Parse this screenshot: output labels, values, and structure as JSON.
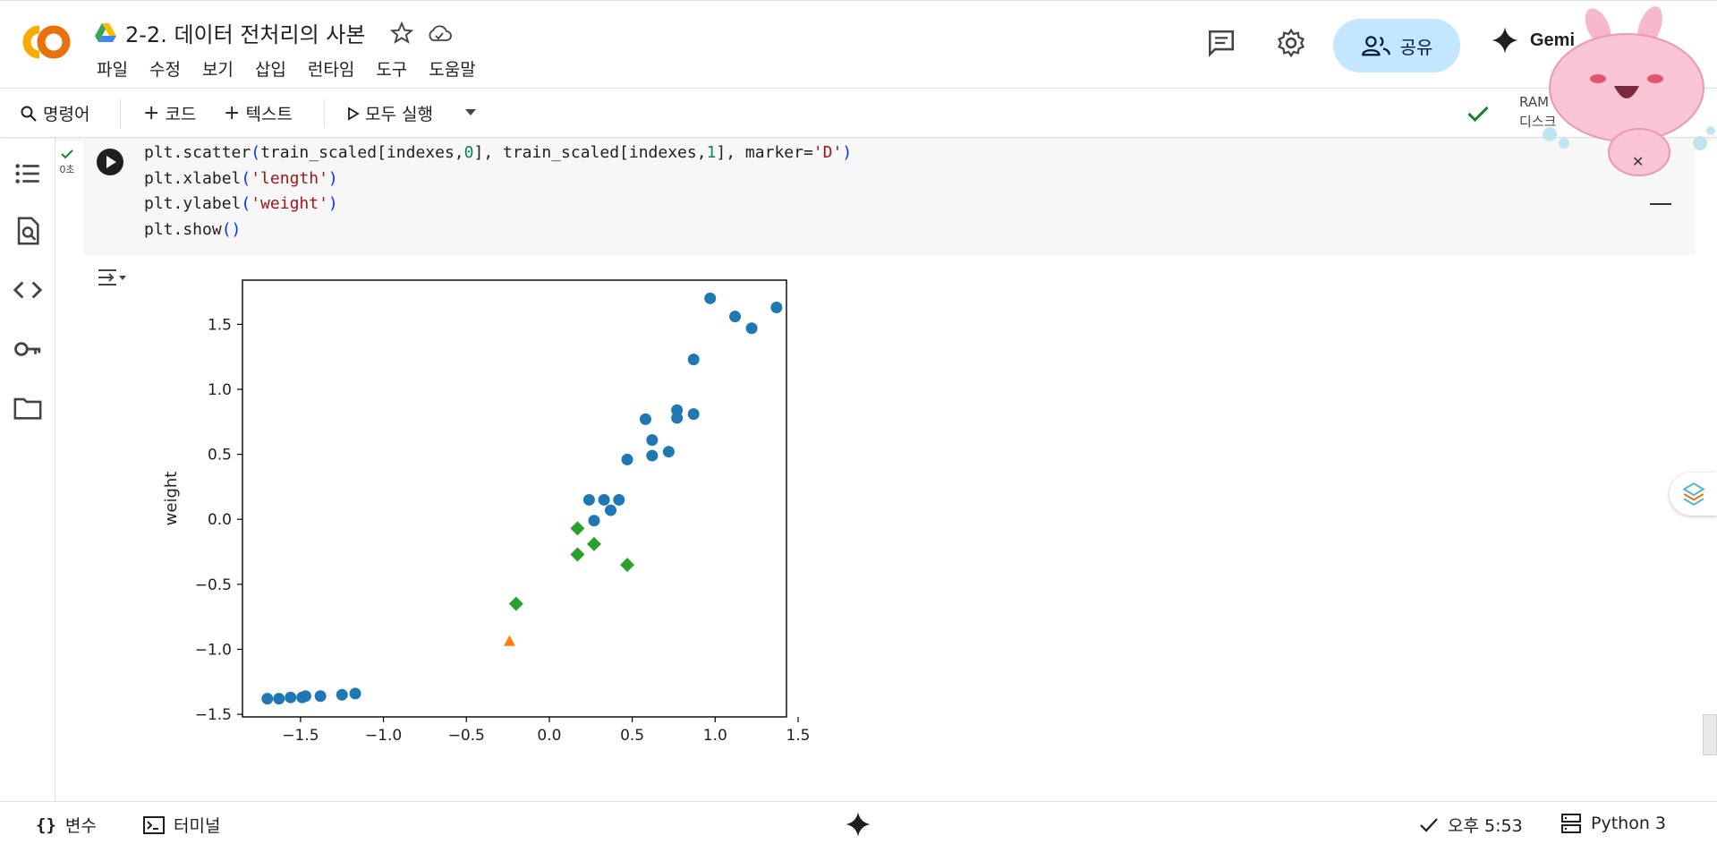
{
  "header": {
    "doc_title": "2-2. 데이터 전처리의 사본",
    "menu": [
      "파일",
      "수정",
      "보기",
      "삽입",
      "런타임",
      "도구",
      "도움말"
    ],
    "share_label": "공유",
    "gemini_label": "Gemi"
  },
  "toolbar": {
    "commands_label": "명령어",
    "code_label": "코드",
    "text_label": "텍스트",
    "run_all_label": "모두 실행",
    "ram_label": "RAM",
    "disk_label": "디스크"
  },
  "cell": {
    "exec_time": "0초",
    "code_lines": [
      [
        {
          "t": "plt.scatter"
        },
        {
          "t": "(",
          "c": "paren"
        },
        {
          "t": "train_scaled[indexes,"
        },
        {
          "t": "0",
          "c": "num"
        },
        {
          "t": "], train_scaled[indexes,"
        },
        {
          "t": "1",
          "c": "num"
        },
        {
          "t": "], marker="
        },
        {
          "t": "'D'",
          "c": "str"
        },
        {
          "t": ")",
          "c": "paren"
        }
      ],
      [
        {
          "t": "plt.xlabel"
        },
        {
          "t": "(",
          "c": "paren"
        },
        {
          "t": "'length'",
          "c": "str"
        },
        {
          "t": ")",
          "c": "paren"
        }
      ],
      [
        {
          "t": "plt.ylabel"
        },
        {
          "t": "(",
          "c": "paren"
        },
        {
          "t": "'weight'",
          "c": "str"
        },
        {
          "t": ")",
          "c": "paren"
        }
      ],
      [
        {
          "t": "plt.show"
        },
        {
          "t": "()",
          "c": "paren"
        }
      ]
    ]
  },
  "chart_data": {
    "type": "scatter",
    "title": "",
    "xlabel": "",
    "ylabel": "weight",
    "xlim": [
      -1.85,
      1.43
    ],
    "ylim": [
      -1.52,
      1.84
    ],
    "xticks": [
      -1.5,
      -1.0,
      -0.5,
      0.0,
      0.5,
      1.0,
      1.5
    ],
    "xtick_labels": [
      "−1.5",
      "−1.0",
      "−0.5",
      "0.0",
      "0.5",
      "1.0",
      "1.5"
    ],
    "yticks": [
      -1.5,
      -1.0,
      -0.5,
      0.0,
      0.5,
      1.0,
      1.5
    ],
    "ytick_labels": [
      "−1.5",
      "−1.0",
      "−0.5",
      "0.0",
      "0.5",
      "1.0",
      "1.5"
    ],
    "grid": false,
    "series": [
      {
        "marker": "circle",
        "color": "#1f77b4",
        "points": [
          [
            -1.7,
            -1.38
          ],
          [
            -1.63,
            -1.38
          ],
          [
            -1.56,
            -1.37
          ],
          [
            -1.49,
            -1.37
          ],
          [
            -1.47,
            -1.36
          ],
          [
            -1.38,
            -1.36
          ],
          [
            -1.25,
            -1.35
          ],
          [
            -1.17,
            -1.34
          ],
          [
            0.24,
            0.15
          ],
          [
            0.27,
            -0.01
          ],
          [
            0.33,
            0.15
          ],
          [
            0.37,
            0.07
          ],
          [
            0.42,
            0.15
          ],
          [
            0.47,
            0.46
          ],
          [
            0.58,
            0.77
          ],
          [
            0.62,
            0.61
          ],
          [
            0.62,
            0.49
          ],
          [
            0.72,
            0.52
          ],
          [
            0.77,
            0.84
          ],
          [
            0.77,
            0.78
          ],
          [
            0.87,
            0.81
          ],
          [
            0.87,
            1.23
          ],
          [
            0.97,
            1.7
          ],
          [
            1.12,
            1.56
          ],
          [
            1.22,
            1.47
          ],
          [
            1.37,
            1.63
          ]
        ]
      },
      {
        "marker": "triangle",
        "color": "#ff7f0e",
        "points": [
          [
            -0.24,
            -0.94
          ]
        ]
      },
      {
        "marker": "diamond",
        "color": "#2ca02c",
        "points": [
          [
            0.17,
            -0.07
          ],
          [
            0.17,
            -0.27
          ],
          [
            0.27,
            -0.19
          ],
          [
            0.47,
            -0.35
          ],
          [
            -0.2,
            -0.65
          ]
        ]
      }
    ]
  },
  "status": {
    "variables_label": "변수",
    "terminal_label": "터미널",
    "time_label": "오후 5:53",
    "runtime_label": "Python 3"
  }
}
